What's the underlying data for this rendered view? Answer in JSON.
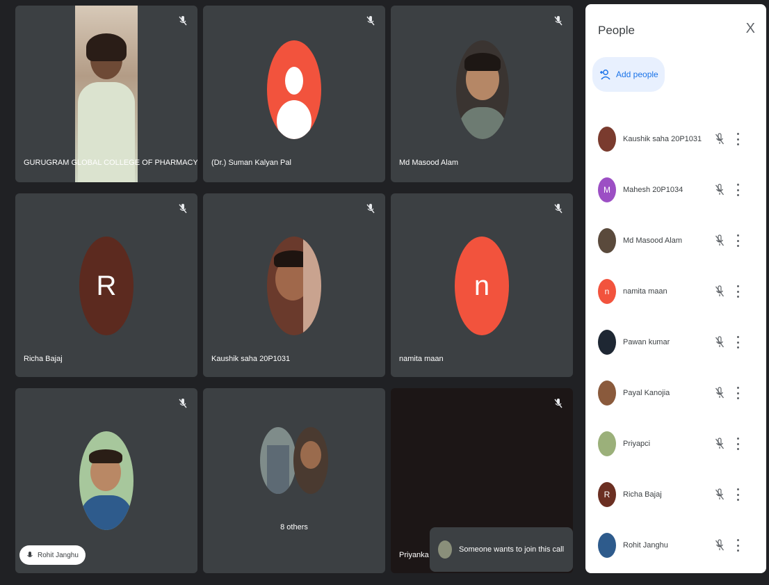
{
  "panel": {
    "title": "People",
    "close": "X",
    "add_people": "Add people",
    "participants": [
      {
        "name": "Kaushik saha 20P1031",
        "avatar": "photo",
        "color": "#7a3b2e"
      },
      {
        "name": "Mahesh 20P1034",
        "avatar": "letter",
        "letter": "M",
        "color": "#9c4fc4"
      },
      {
        "name": "Md Masood Alam",
        "avatar": "photo",
        "color": "#5a4a3c"
      },
      {
        "name": "namita maan",
        "avatar": "letter",
        "letter": "n",
        "color": "#f2533d"
      },
      {
        "name": "Pawan kumar",
        "avatar": "photo",
        "color": "#1e2733"
      },
      {
        "name": "Payal Kanojia",
        "avatar": "photo",
        "color": "#8a5a3c"
      },
      {
        "name": "Priyapci",
        "avatar": "photo",
        "color": "#9bb07a"
      },
      {
        "name": "Richa Bajaj",
        "avatar": "letter",
        "letter": "R",
        "color": "#6b2f22"
      },
      {
        "name": "Rohit Janghu",
        "avatar": "photo",
        "color": "#2e5b8c"
      }
    ]
  },
  "tiles": [
    {
      "name": "GURUGRAM GLOBAL COLLEGE OF PHARMACY"
    },
    {
      "name": "(Dr.) Suman Kalyan Pal"
    },
    {
      "name": "Md Masood Alam"
    },
    {
      "name": "Richa Bajaj",
      "letter": "R",
      "color": "#5c2a1f"
    },
    {
      "name": "Kaushik saha 20P1031"
    },
    {
      "name": "namita maan",
      "letter": "n",
      "color": "#f2533d"
    },
    {
      "name": ""
    },
    {
      "name": "8 others"
    },
    {
      "name": "Priyanka"
    }
  ],
  "chip": {
    "label": "Rohit Janghu"
  },
  "toast": {
    "text": "Someone wants to join this call"
  },
  "colors": {
    "background": "#202124",
    "tile": "#3c4043",
    "accent": "#1a73e8"
  }
}
